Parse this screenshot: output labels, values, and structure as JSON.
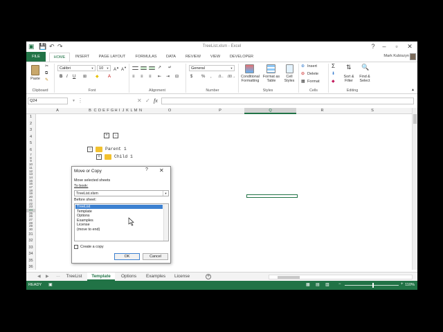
{
  "app": {
    "title": "TreeList.xlsm - Excel",
    "user_name": "Mark Kubiszyn"
  },
  "ribbon_tabs": [
    "FILE",
    "HOME",
    "INSERT",
    "PAGE LAYOUT",
    "FORMULAS",
    "DATA",
    "REVIEW",
    "VIEW",
    "DEVELOPER"
  ],
  "ribbon": {
    "clipboard": {
      "label": "Clipboard",
      "paste": "Paste"
    },
    "font": {
      "label": "Font",
      "name": "Calibri",
      "size": "10",
      "bold": "B",
      "italic": "I",
      "underline": "U"
    },
    "alignment": {
      "label": "Alignment"
    },
    "number": {
      "label": "Number",
      "format": "General",
      "currency": "$",
      "percent": "%",
      "comma": ","
    },
    "styles": {
      "label": "Styles",
      "conditional": "Conditional Formatting",
      "format_table": "Format as Table",
      "cell_styles": "Cell Styles"
    },
    "cells": {
      "label": "Cells",
      "insert": "Insert",
      "delete": "Delete",
      "format": "Format"
    },
    "editing": {
      "label": "Editing",
      "sort": "Sort & Filter",
      "find": "Find & Select"
    }
  },
  "formula_bar": {
    "name_box": "Q24",
    "fx": "fx",
    "content": ""
  },
  "columns": [
    "A",
    "B",
    "C",
    "D",
    "E",
    "F",
    "G",
    "H",
    "I",
    "J",
    "K",
    "L",
    "M",
    "N",
    "O",
    "P",
    "Q",
    "R",
    "S"
  ],
  "selected_column": "Q",
  "rows": [
    "1",
    "2",
    "3",
    "4",
    "5",
    "6",
    "7",
    "8",
    "9",
    "10",
    "11",
    "12",
    "13",
    "14",
    "15",
    "16",
    "17",
    "18",
    "19",
    "20",
    "21",
    "22",
    "23",
    "24",
    "25",
    "26",
    "27",
    "28",
    "29",
    "30",
    "31",
    "32",
    "33",
    "34",
    "35",
    "36",
    "37",
    "38",
    "39",
    "40",
    "41",
    "42",
    "43",
    "44"
  ],
  "selected_row": "24",
  "tree": {
    "parent": "Parent 1",
    "child": "Child 1",
    "expand": "+",
    "collapse": "−"
  },
  "sheet_tabs": [
    "TreeList",
    "Template",
    "Options",
    "Examples",
    "License"
  ],
  "active_sheet": "Template",
  "status": {
    "text": "READY",
    "zoom": "110%"
  },
  "dialog": {
    "title": "Move or Copy",
    "help": "?",
    "close": "✕",
    "move_label": "Move selected sheets",
    "to_book_label": "To book:",
    "to_book_value": "TreeList.xlsm",
    "before_label": "Before sheet:",
    "before_items": [
      "TreeList",
      "Template",
      "Options",
      "Examples",
      "License",
      "(move to end)"
    ],
    "selected_item": "TreeList",
    "create_copy_label": "Create a copy",
    "create_copy_checked": false,
    "ok": "OK",
    "cancel": "Cancel"
  },
  "colors": {
    "excel_green": "#217346",
    "selection_blue": "#3c80d0"
  }
}
